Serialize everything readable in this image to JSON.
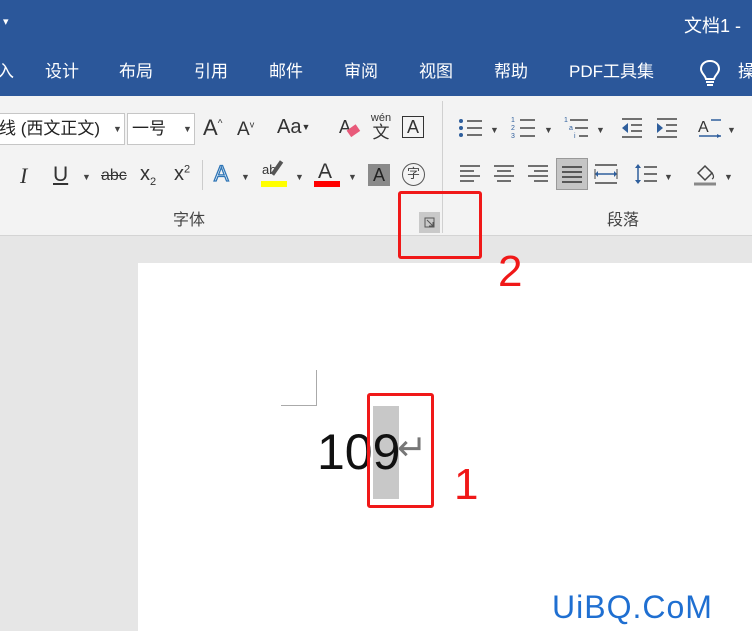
{
  "window": {
    "title": "文档1 -"
  },
  "menu": [
    "设计",
    "布局",
    "引用",
    "邮件",
    "审阅",
    "视图",
    "帮助",
    "PDF工具集"
  ],
  "font": {
    "name": "线 (西文正文)",
    "size": "一号"
  },
  "ribbon": {
    "aa_label": "Aa",
    "phonetic_top": "wén",
    "phonetic_bottom": "文",
    "char_border": "A",
    "italic": "I",
    "underline": "U",
    "strike": "abc",
    "sub": "x",
    "sub_2": "2",
    "sup": "x",
    "sup_2": "2",
    "text_effect": "A",
    "font_color": "A",
    "shading": "A",
    "enclose": "字",
    "grow": "A",
    "shrink": "A",
    "highlight": "ab"
  },
  "groups": {
    "font": "字体",
    "paragraph": "段落"
  },
  "document": {
    "text_before": "10",
    "text_selected": "9",
    "para_mark": "↵"
  },
  "annotations": {
    "one": "1",
    "two": "2"
  },
  "watermark": "UiBQ.CoM",
  "colors": {
    "brand": "#2b579a",
    "highlight": "#ffff00",
    "font_color": "#ff0000",
    "annotation": "#f01818",
    "selection": "#c8c8c8"
  }
}
